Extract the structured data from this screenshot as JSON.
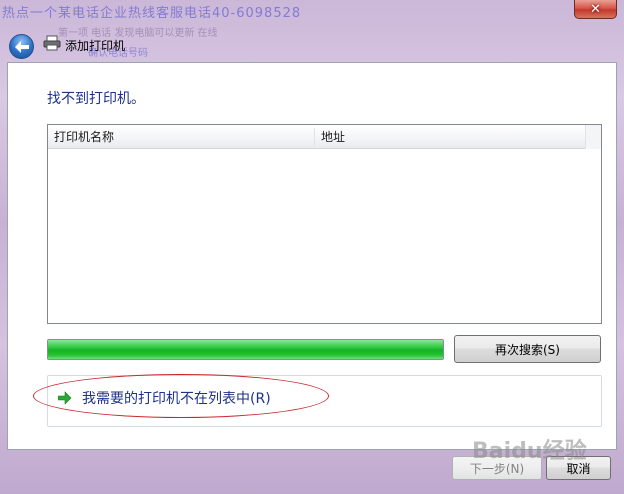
{
  "window": {
    "title": "添加打印机",
    "close_label": "✕",
    "background_text": {
      "line1_prefix": "热点一个某电话企业热线客服电话4",
      "line1_red": "",
      "line1_suffix": "0-6098528",
      "line2": "第一项 电话 发现电脑可以更新 在线",
      "line3": "确认电话号码"
    }
  },
  "dialog": {
    "heading": "找不到打印机。",
    "list": {
      "columns": [
        "打印机名称",
        "地址"
      ],
      "rows": []
    },
    "progress_fraction": 1.0,
    "search_again_label": "再次搜索(S)",
    "not_listed_link": "我需要的打印机不在列表中(R)",
    "next_label": "下一步(N)",
    "cancel_label": "取消"
  },
  "watermark_text": "Baidu经验",
  "colors": {
    "link_blue": "#1e3287",
    "progress_green": "#16b225",
    "annotation_red": "#c8282c",
    "close_red": "#c23a2b"
  },
  "icons": [
    "back-arrow-icon",
    "printer-icon",
    "green-arrow-icon",
    "close-icon"
  ]
}
